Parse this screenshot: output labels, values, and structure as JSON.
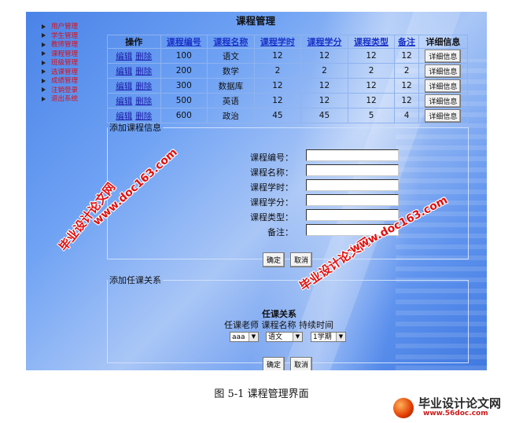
{
  "page_title": "课程管理",
  "nav": [
    "用户管理",
    "学生管理",
    "教师管理",
    "课程管理",
    "班级管理",
    "选课管理",
    "成绩管理",
    "注销登录",
    "退出系统"
  ],
  "table": {
    "headers": [
      "操作",
      "课程编号",
      "课程名称",
      "课程学时",
      "课程学分",
      "课程类型",
      "备注",
      "详细信息"
    ],
    "edit_label": "编辑",
    "delete_label": "删除",
    "detail_button": "详细信息",
    "rows": [
      [
        "100",
        "语文",
        "12",
        "12",
        "12",
        "12"
      ],
      [
        "200",
        "数学",
        "2",
        "2",
        "2",
        "2"
      ],
      [
        "300",
        "数据库",
        "12",
        "12",
        "12",
        "12"
      ],
      [
        "500",
        "英语",
        "12",
        "12",
        "12",
        "12"
      ],
      [
        "600",
        "政治",
        "45",
        "45",
        "5",
        "4"
      ]
    ]
  },
  "add_course": {
    "legend": "添加课程信息",
    "fields": [
      "课程编号：",
      "课程名称：",
      "课程学时：",
      "课程学分：",
      "课程类型：",
      "备注："
    ],
    "confirm": "确定",
    "cancel": "取消"
  },
  "add_relation": {
    "legend": "添加任课关系",
    "title": "任课关系",
    "column_heads": "任课老师 课程名称  持续时间",
    "teacher_value": "aaa",
    "course_value": "语文",
    "duration_value": "1学期",
    "confirm": "确定",
    "cancel": "取消"
  },
  "watermarks": [
    "毕业设计论文网",
    "www.doc163.com"
  ],
  "caption": "图 5-1  课程管理界面",
  "site_logo": {
    "name": "毕业设计论文网",
    "url": "www.56doc.com"
  }
}
